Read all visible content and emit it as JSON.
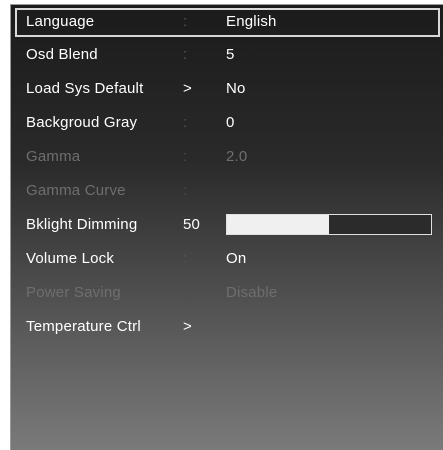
{
  "menu": {
    "items": [
      {
        "label": "Language",
        "sep": ":",
        "value": "English",
        "state": "selected"
      },
      {
        "label": "Osd Blend",
        "sep": ":",
        "value": "5",
        "state": "normal"
      },
      {
        "label": "Load Sys Default",
        "sep": ">",
        "value": "No",
        "state": "normal"
      },
      {
        "label": "Backgroud Gray",
        "sep": ":",
        "value": "0",
        "state": "normal"
      },
      {
        "label": "Gamma",
        "sep": ":",
        "value": "2.0",
        "state": "disabled"
      },
      {
        "label": "Gamma Curve",
        "sep": ":",
        "value": "",
        "state": "disabled"
      },
      {
        "label": "Bklight Dimming",
        "sep": "50",
        "value": "",
        "state": "normal",
        "bar_fraction": 0.5
      },
      {
        "label": "Volume Lock",
        "sep": ":",
        "value": "On",
        "state": "normal"
      },
      {
        "label": "Power Saving",
        "sep": ":",
        "value": "Disable",
        "state": "disabled"
      },
      {
        "label": "Temperature Ctrl",
        "sep": ">",
        "value": "",
        "state": "normal"
      }
    ]
  },
  "colors": {
    "text": "#ffffff",
    "disabled_text": "#6e6e6e",
    "bar_fill": "#f0f0f0",
    "selection_border": "#d8d8d8"
  }
}
